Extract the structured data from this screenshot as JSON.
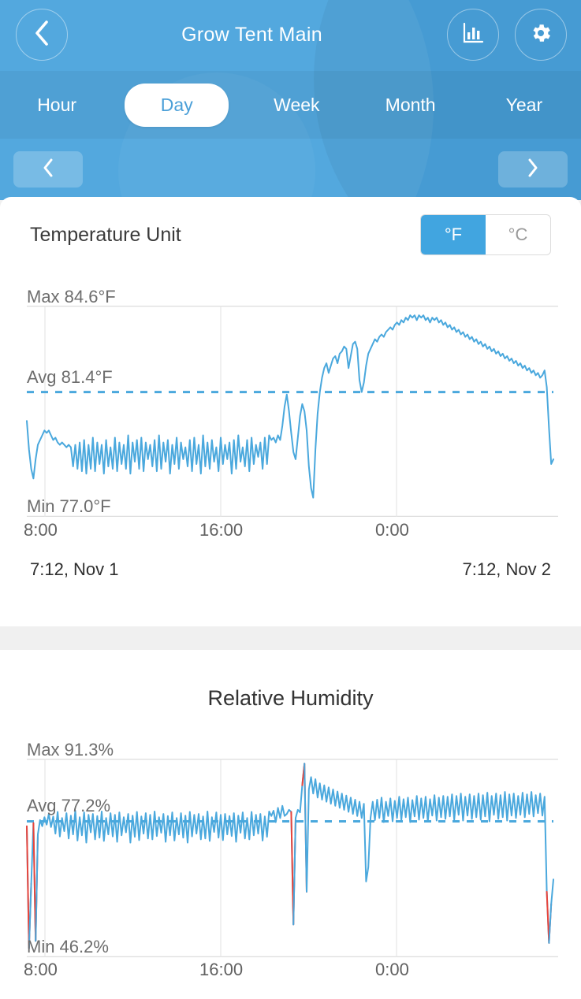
{
  "header": {
    "title": "Grow Tent Main",
    "back_icon": "chevron-left-icon",
    "stats_icon": "bar-chart-icon",
    "settings_icon": "gear-icon",
    "brand_color": "#4aa3dd"
  },
  "tabs": [
    {
      "label": "Hour",
      "active": false
    },
    {
      "label": "Day",
      "active": true
    },
    {
      "label": "Week",
      "active": false
    },
    {
      "label": "Month",
      "active": false
    },
    {
      "label": "Year",
      "active": false
    }
  ],
  "date_nav": {
    "prev_icon": "chevron-left-icon",
    "next_icon": "chevron-right-icon"
  },
  "temperature_unit": {
    "label": "Temperature Unit",
    "options": [
      "°F",
      "°C"
    ],
    "selected": "°F",
    "selected_index": 0,
    "accent": "#41a5e0"
  },
  "humidity_section": {
    "title": "Relative Humidity"
  },
  "chart_data": [
    {
      "type": "line",
      "id": "temperature",
      "title": "",
      "ylabel": "°F",
      "xlabel": "",
      "max_label": "Max 84.6°F",
      "avg_label": "Avg 81.4°F",
      "min_label": "Min 77.0°F",
      "max": 84.6,
      "avg": 81.4,
      "min": 77.0,
      "ylim": [
        76.2,
        85.0
      ],
      "grid": true,
      "line_color": "#4aa8dd",
      "avg_line_color": "#4aa8dd",
      "avg_line_style": "dashed",
      "xticks": [
        "8:00",
        "16:00",
        "0:00"
      ],
      "xtick_positions": [
        57,
        280,
        503
      ],
      "range_start": "7:12,  Nov 1",
      "range_end": "7:12,  Nov 2",
      "values": [
        80.2,
        79.0,
        78.2,
        77.8,
        78.6,
        79.2,
        79.4,
        79.6,
        79.8,
        79.7,
        79.8,
        79.6,
        79.4,
        79.5,
        79.3,
        79.2,
        79.3,
        79.2,
        79.1,
        79.2,
        79.1,
        78.3,
        79.2,
        78.2,
        79.3,
        78.1,
        79.4,
        78.0,
        79.2,
        78.2,
        79.5,
        78.1,
        79.3,
        78.4,
        79.2,
        78.0,
        79.4,
        78.3,
        79.1,
        78.2,
        79.5,
        78.1,
        79.3,
        78.4,
        79.2,
        78.2,
        79.6,
        78.0,
        79.3,
        78.5,
        79.4,
        78.2,
        79.5,
        78.1,
        79.3,
        78.6,
        79.2,
        78.3,
        79.4,
        78.1,
        79.6,
        78.2,
        79.3,
        78.5,
        79.4,
        78.0,
        79.2,
        78.4,
        79.5,
        78.2,
        79.3,
        78.6,
        79.1,
        78.3,
        79.4,
        78.1,
        79.5,
        78.4,
        79.2,
        78.0,
        79.6,
        78.3,
        79.3,
        78.2,
        79.4,
        78.5,
        79.1,
        78.1,
        79.5,
        78.4,
        79.2,
        78.6,
        79.3,
        78.0,
        79.4,
        78.2,
        79.6,
        78.5,
        79.1,
        78.3,
        79.4,
        78.1,
        79.5,
        78.4,
        79.2,
        78.7,
        79.3,
        78.2,
        79.5,
        78.4,
        79.6,
        79.4,
        79.5,
        79.3,
        79.6,
        79.4,
        80.0,
        80.8,
        81.3,
        80.6,
        79.7,
        78.9,
        78.6,
        79.5,
        80.4,
        80.9,
        80.6,
        79.8,
        78.3,
        77.4,
        77.0,
        79.0,
        80.5,
        81.4,
        82.0,
        82.4,
        82.6,
        82.2,
        82.5,
        82.8,
        82.9,
        82.6,
        83.0,
        83.1,
        83.3,
        83.2,
        82.4,
        82.9,
        83.4,
        83.5,
        83.2,
        81.9,
        81.4,
        81.8,
        82.5,
        83.0,
        83.2,
        83.4,
        83.6,
        83.5,
        83.7,
        83.8,
        83.7,
        83.9,
        84.0,
        84.1,
        84.0,
        84.2,
        84.3,
        84.2,
        84.4,
        84.3,
        84.5,
        84.4,
        84.6,
        84.5,
        84.6,
        84.4,
        84.6,
        84.5,
        84.6,
        84.4,
        84.5,
        84.3,
        84.5,
        84.4,
        84.5,
        84.3,
        84.4,
        84.2,
        84.3,
        84.1,
        84.2,
        84.0,
        84.1,
        83.9,
        84.0,
        83.8,
        83.9,
        83.7,
        83.8,
        83.6,
        83.7,
        83.5,
        83.6,
        83.4,
        83.5,
        83.3,
        83.4,
        83.2,
        83.3,
        83.1,
        83.2,
        83.0,
        83.1,
        82.9,
        83.0,
        82.8,
        82.9,
        82.7,
        82.8,
        82.6,
        82.7,
        82.5,
        82.6,
        82.4,
        82.5,
        82.3,
        82.4,
        82.2,
        82.3,
        82.1,
        82.2,
        82.0,
        82.1,
        82.3,
        81.6,
        79.9,
        78.4,
        78.6
      ]
    },
    {
      "type": "line",
      "id": "humidity",
      "title": "Relative Humidity",
      "ylabel": "%",
      "xlabel": "",
      "max_label": "Max 91.3%",
      "avg_label": "Avg 77.2%",
      "min_label": "Min 46.2%",
      "max": 91.3,
      "avg": 77.2,
      "min": 46.2,
      "ylim": [
        44.0,
        92.5
      ],
      "grid": true,
      "line_color": "#4aa8dd",
      "alarm_color": "#e8453c",
      "avg_line_color": "#4aa8dd",
      "avg_line_style": "dashed",
      "xticks": [
        "8:00",
        "16:00",
        "0:00"
      ],
      "xtick_positions": [
        57,
        280,
        503
      ],
      "values": [
        76.0,
        46.2,
        62.0,
        76.8,
        48.0,
        74.0,
        77.5,
        76.0,
        78.2,
        76.4,
        79.0,
        75.8,
        78.4,
        74.2,
        79.5,
        73.5,
        78.0,
        74.8,
        79.2,
        73.0,
        78.6,
        74.0,
        79.8,
        72.5,
        78.2,
        73.8,
        79.4,
        72.0,
        78.8,
        74.5,
        79.0,
        72.8,
        78.5,
        73.2,
        79.6,
        72.4,
        78.0,
        74.0,
        79.2,
        73.5,
        78.8,
        72.2,
        79.4,
        73.8,
        78.2,
        74.5,
        79.0,
        72.0,
        78.6,
        73.4,
        79.5,
        72.6,
        78.4,
        74.2,
        79.2,
        73.0,
        78.8,
        72.8,
        79.6,
        73.6,
        78.2,
        74.4,
        79.0,
        72.2,
        78.5,
        73.8,
        79.4,
        72.5,
        78.0,
        74.0,
        79.2,
        73.2,
        78.6,
        72.0,
        79.5,
        73.5,
        78.8,
        74.2,
        79.0,
        72.8,
        78.4,
        73.0,
        79.6,
        72.4,
        78.2,
        74.6,
        79.4,
        73.2,
        78.8,
        72.6,
        79.0,
        74.0,
        78.5,
        73.6,
        79.2,
        72.2,
        78.6,
        74.4,
        79.4,
        73.0,
        78.0,
        72.8,
        79.5,
        73.8,
        78.8,
        74.2,
        79.0,
        72.5,
        78.4,
        73.4,
        79.6,
        78.5,
        79.8,
        77.0,
        80.5,
        78.0,
        81.0,
        78.5,
        79.0,
        80.0,
        79.5,
        52.0,
        78.0,
        80.0,
        79.4,
        86.0,
        91.3,
        60.0,
        85.0,
        88.0,
        84.0,
        87.5,
        83.0,
        86.5,
        82.5,
        86.0,
        82.0,
        85.5,
        81.5,
        85.0,
        81.0,
        84.5,
        80.5,
        84.0,
        80.0,
        83.5,
        79.5,
        83.0,
        79.0,
        82.5,
        78.5,
        82.0,
        78.0,
        81.5,
        62.5,
        66.0,
        78.0,
        82.0,
        77.5,
        82.5,
        78.0,
        83.0,
        77.0,
        82.0,
        78.5,
        82.8,
        77.2,
        82.2,
        78.0,
        83.2,
        77.5,
        82.6,
        78.2,
        83.0,
        77.0,
        82.4,
        78.4,
        83.4,
        77.6,
        82.8,
        78.0,
        83.2,
        77.2,
        82.6,
        78.6,
        83.6,
        77.4,
        83.0,
        78.2,
        83.4,
        77.8,
        83.2,
        78.4,
        83.8,
        77.6,
        83.4,
        78.8,
        84.0,
        77.4,
        83.2,
        78.6,
        83.8,
        77.8,
        83.4,
        78.2,
        84.0,
        77.6,
        83.6,
        78.4,
        84.2,
        77.2,
        83.4,
        78.8,
        84.0,
        77.8,
        83.6,
        78.2,
        84.4,
        77.4,
        83.8,
        78.6,
        84.0,
        78.0,
        83.4,
        78.8,
        84.2,
        78.2,
        83.8,
        79.0,
        84.4,
        78.4,
        83.6,
        79.2,
        84.0,
        78.6,
        83.2,
        60.0,
        47.5,
        57.0,
        63.0
      ]
    }
  ]
}
